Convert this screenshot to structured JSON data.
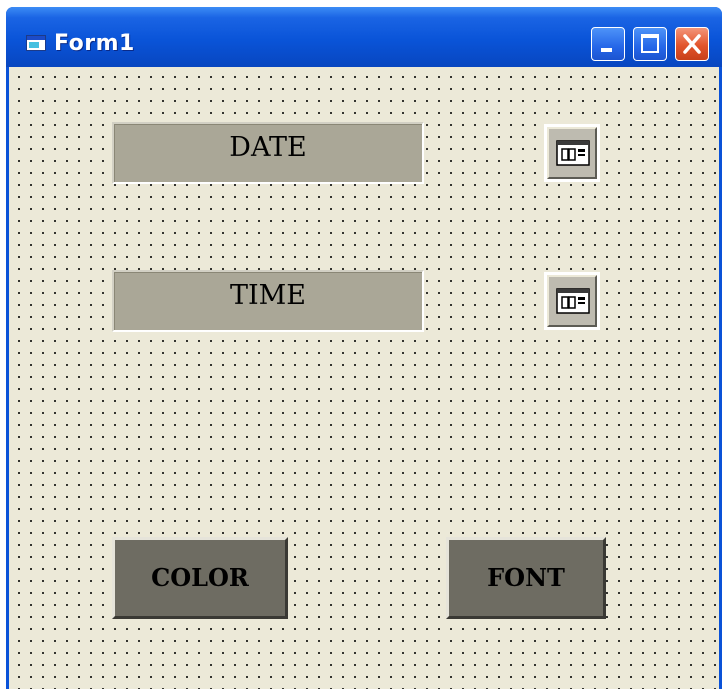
{
  "window": {
    "title": "Form1",
    "icon": "form-icon",
    "controls": [
      "minimize-icon",
      "maximize-icon",
      "close-icon"
    ]
  },
  "form": {
    "date_label": "DATE",
    "time_label": "TIME",
    "date_picker_icon": "calendar-icon",
    "time_picker_icon": "calendar-icon",
    "color_button": "COLOR",
    "font_button": "FONT"
  },
  "colors": {
    "title_bar": "#0a54d8",
    "client_background": "#ece9d8",
    "label_background": "#aaa797",
    "button_background": "#6e6c62",
    "close_button": "#e2542c"
  }
}
